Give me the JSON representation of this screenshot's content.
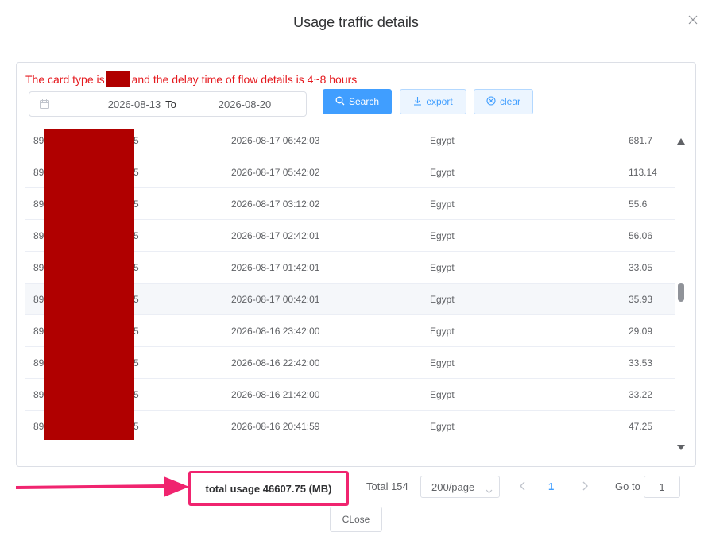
{
  "dialog": {
    "title": "Usage traffic details",
    "close_icon": "close-icon"
  },
  "notice": {
    "prefix": "The card type is",
    "suffix": "and the delay time of flow details is 4~8 hours",
    "color": "#e5191e"
  },
  "filter": {
    "start_date": "2026-08-13",
    "separator": "To",
    "end_date": "2026-08-20",
    "search_label": "Search",
    "export_label": "export",
    "clear_label": "clear"
  },
  "table": {
    "rows": [
      {
        "id_prefix": "89",
        "id_suffix": "5",
        "time": "2026-08-17 06:42:03",
        "country": "Egypt",
        "usage": "681.7"
      },
      {
        "id_prefix": "89",
        "id_suffix": "5",
        "time": "2026-08-17 05:42:02",
        "country": "Egypt",
        "usage": "113.14"
      },
      {
        "id_prefix": "89",
        "id_suffix": "5",
        "time": "2026-08-17 03:12:02",
        "country": "Egypt",
        "usage": "55.6"
      },
      {
        "id_prefix": "89",
        "id_suffix": "5",
        "time": "2026-08-17 02:42:01",
        "country": "Egypt",
        "usage": "56.06"
      },
      {
        "id_prefix": "89",
        "id_suffix": "5",
        "time": "2026-08-17 01:42:01",
        "country": "Egypt",
        "usage": "33.05"
      },
      {
        "id_prefix": "89",
        "id_suffix": "5",
        "time": "2026-08-17 00:42:01",
        "country": "Egypt",
        "usage": "35.93"
      },
      {
        "id_prefix": "89",
        "id_suffix": "5",
        "time": "2026-08-16 23:42:00",
        "country": "Egypt",
        "usage": "29.09"
      },
      {
        "id_prefix": "89",
        "id_suffix": "5",
        "time": "2026-08-16 22:42:00",
        "country": "Egypt",
        "usage": "33.53"
      },
      {
        "id_prefix": "89",
        "id_suffix": "5",
        "time": "2026-08-16 21:42:00",
        "country": "Egypt",
        "usage": "33.22"
      },
      {
        "id_prefix": "89",
        "id_suffix": "5",
        "time": "2026-08-16 20:41:59",
        "country": "Egypt",
        "usage": "47.25"
      }
    ],
    "redaction_color": "#b00000"
  },
  "footer": {
    "total_usage": "total usage 46607.75 (MB)",
    "highlight_color": "#f0246f",
    "total_count": "Total 154",
    "page_size": "200/page",
    "current_page": "1",
    "goto_label": "Go to",
    "goto_value": "1",
    "close_label": "CLose"
  },
  "colors": {
    "accent": "#409eff"
  }
}
